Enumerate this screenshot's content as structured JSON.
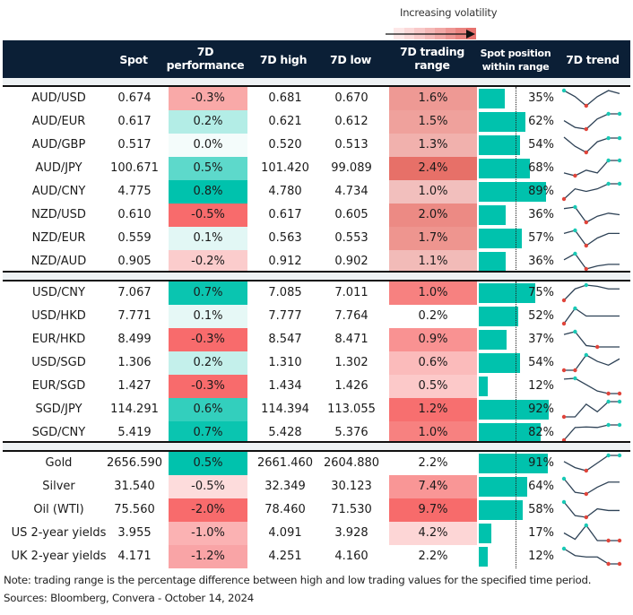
{
  "legend": {
    "label": "Increasing volatility",
    "icon": "arrow-right-icon",
    "gradient": [
      "#fde8e8",
      "#fbd9d9",
      "#f8c9c9",
      "#f5b9b8",
      "#f2a8a6",
      "#ee9693",
      "#ea8480",
      "#e7726e"
    ]
  },
  "header": {
    "spot": "Spot",
    "perf_line1": "7D",
    "perf_line2": "performance",
    "high": "7D high",
    "low": "7D low",
    "range_line1": "7D trading",
    "range_line2": "range",
    "pos_line1": "Spot position",
    "pos_line2": "within range",
    "trend": "7D trend"
  },
  "colors": {
    "header_bg": "#0b1f36",
    "bar": "#00c2ad",
    "spark_line": "#2e4256",
    "spark_high": "#19c9b5",
    "spark_low": "#e0443a"
  },
  "chart_data": {
    "type": "table",
    "title": "",
    "columns": [
      "Instrument",
      "Spot",
      "7D performance",
      "7D high",
      "7D low",
      "7D trading range",
      "Spot position within range",
      "7D trend"
    ],
    "groups": [
      {
        "rows": [
          {
            "name": "AUD/USD",
            "spot": "0.674",
            "perf": "-0.3%",
            "perf_bg": "#f9a9a8",
            "high": "0.681",
            "low": "0.670",
            "range": "1.6%",
            "range_bg": "#ee9994",
            "pos": 35,
            "pos_label": "35%",
            "trend": [
              6,
              4,
              1,
              4,
              6,
              5
            ],
            "trend_hi": [
              0
            ],
            "trend_lo": [
              2
            ]
          },
          {
            "name": "AUD/EUR",
            "spot": "0.617",
            "perf": "0.2%",
            "perf_bg": "#b3ede6",
            "high": "0.621",
            "low": "0.612",
            "range": "1.5%",
            "range_bg": "#efa19c",
            "pos": 62,
            "pos_label": "62%",
            "trend": [
              4,
              2,
              1.5,
              4.5,
              6,
              6
            ],
            "trend_hi": [
              4,
              5
            ],
            "trend_lo": [
              2
            ]
          },
          {
            "name": "AUD/GBP",
            "spot": "0.517",
            "perf": "0.0%",
            "perf_bg": "#f4fcfb",
            "high": "0.520",
            "low": "0.513",
            "range": "1.3%",
            "range_bg": "#f1b1ad",
            "pos": 54,
            "pos_label": "54%",
            "trend": [
              6,
              3,
              1,
              4.5,
              5.7,
              5.7
            ],
            "trend_hi": [
              4,
              5
            ],
            "trend_lo": [
              2
            ]
          },
          {
            "name": "AUD/JPY",
            "spot": "100.671",
            "perf": "0.5%",
            "perf_bg": "#5dd9cb",
            "high": "101.420",
            "low": "99.089",
            "range": "2.4%",
            "range_bg": "#e77068",
            "pos": 68,
            "pos_label": "68%",
            "trend": [
              1.5,
              0.5,
              2.5,
              1.5,
              6,
              6
            ],
            "trend_hi": [
              4,
              5
            ],
            "trend_lo": [
              1
            ]
          },
          {
            "name": "AUD/CNY",
            "spot": "4.775",
            "perf": "0.8%",
            "perf_bg": "#00c2ad",
            "high": "4.780",
            "low": "4.734",
            "range": "1.0%",
            "range_bg": "#f2bfbd",
            "pos": 89,
            "pos_label": "89%",
            "trend": [
              0.5,
              4.5,
              3.5,
              4.5,
              6.5,
              6.5
            ],
            "trend_hi": [
              4,
              5
            ],
            "trend_lo": [
              0
            ]
          },
          {
            "name": "NZD/USD",
            "spot": "0.610",
            "perf": "-0.5%",
            "perf_bg": "#f86b6c",
            "high": "0.617",
            "low": "0.605",
            "range": "2.0%",
            "range_bg": "#ec8a84",
            "pos": 36,
            "pos_label": "36%",
            "trend": [
              5.5,
              6,
              1,
              3,
              4,
              3.5
            ],
            "trend_hi": [
              1
            ],
            "trend_lo": [
              2
            ]
          },
          {
            "name": "NZD/EUR",
            "spot": "0.559",
            "perf": "0.1%",
            "perf_bg": "#e2f7f5",
            "high": "0.563",
            "low": "0.553",
            "range": "1.7%",
            "range_bg": "#ee958f",
            "pos": 57,
            "pos_label": "57%",
            "trend": [
              4.5,
              5.5,
              0.5,
              3,
              4.5,
              4.5
            ],
            "trend_hi": [
              1
            ],
            "trend_lo": [
              2
            ]
          },
          {
            "name": "NZD/AUD",
            "spot": "0.905",
            "perf": "-0.2%",
            "perf_bg": "#fbcccc",
            "high": "0.912",
            "low": "0.902",
            "range": "1.1%",
            "range_bg": "#f2bbb8",
            "pos": 36,
            "pos_label": "36%",
            "trend": [
              3,
              5,
              0,
              1,
              1.5,
              1.5
            ],
            "trend_hi": [
              1
            ],
            "trend_lo": [
              2
            ]
          }
        ]
      },
      {
        "rows": [
          {
            "name": "USD/CNY",
            "spot": "7.067",
            "perf": "0.7%",
            "perf_bg": "#0ac5b0",
            "high": "7.085",
            "low": "7.011",
            "range": "1.0%",
            "range_bg": "#f78180",
            "pos": 75,
            "pos_label": "75%",
            "trend": [
              0,
              4.5,
              6,
              5.5,
              4.5,
              4.5
            ],
            "trend_hi": [
              2
            ],
            "trend_lo": [
              0
            ]
          },
          {
            "name": "USD/HKD",
            "spot": "7.771",
            "perf": "0.1%",
            "perf_bg": "#e6f8f6",
            "high": "7.777",
            "low": "7.764",
            "range": "0.2%",
            "range_bg": "#ffffff",
            "pos": 52,
            "pos_label": "52%",
            "trend": [
              0,
              6,
              3,
              3,
              3,
              3
            ],
            "trend_hi": [
              1
            ],
            "trend_lo": [
              0
            ]
          },
          {
            "name": "EUR/HKD",
            "spot": "8.499",
            "perf": "-0.3%",
            "perf_bg": "#f86b6c",
            "high": "8.547",
            "low": "8.471",
            "range": "0.9%",
            "range_bg": "#f99292",
            "pos": 37,
            "pos_label": "37%",
            "trend": [
              4.5,
              5.5,
              0.5,
              0,
              0,
              0
            ],
            "trend_hi": [
              1
            ],
            "trend_lo": [
              3
            ]
          },
          {
            "name": "USD/SGD",
            "spot": "1.306",
            "perf": "0.2%",
            "perf_bg": "#c4f0eb",
            "high": "1.310",
            "low": "1.302",
            "range": "0.6%",
            "range_bg": "#fbbbbb",
            "pos": 54,
            "pos_label": "54%",
            "trend": [
              0,
              0,
              6,
              3.5,
              2,
              4.5
            ],
            "trend_hi": [
              2
            ],
            "trend_lo": [
              0,
              1
            ]
          },
          {
            "name": "EUR/SGD",
            "spot": "1.427",
            "perf": "-0.3%",
            "perf_bg": "#f86b6c",
            "high": "1.434",
            "low": "1.426",
            "range": "0.5%",
            "range_bg": "#fcc9c9",
            "pos": 12,
            "pos_label": "12%",
            "trend": [
              5.7,
              6,
              3.5,
              1,
              0,
              0
            ],
            "trend_hi": [
              1
            ],
            "trend_lo": [
              4,
              5
            ]
          },
          {
            "name": "SGD/JPY",
            "spot": "114.291",
            "perf": "0.6%",
            "perf_bg": "#33cfbd",
            "high": "114.394",
            "low": "113.055",
            "range": "1.2%",
            "range_bg": "#f76f6f",
            "pos": 92,
            "pos_label": "92%",
            "trend": [
              0,
              0,
              5,
              2,
              6,
              6
            ],
            "trend_hi": [
              4,
              5
            ],
            "trend_lo": [
              0
            ]
          },
          {
            "name": "SGD/CNY",
            "spot": "5.419",
            "perf": "0.7%",
            "perf_bg": "#0ac5b0",
            "high": "5.428",
            "low": "5.376",
            "range": "1.0%",
            "range_bg": "#f78180",
            "pos": 82,
            "pos_label": "82%",
            "trend": [
              0,
              5,
              5.2,
              5,
              6,
              6
            ],
            "trend_hi": [
              4,
              5
            ],
            "trend_lo": [
              0
            ]
          }
        ]
      },
      {
        "rows": [
          {
            "name": "Gold",
            "spot": "2656.590",
            "perf": "0.5%",
            "perf_bg": "#00c2ad",
            "high": "2661.460",
            "low": "2604.880",
            "range": "2.2%",
            "range_bg": "#ffffff",
            "pos": 91,
            "pos_label": "91%",
            "trend": [
              4,
              2,
              1,
              3.5,
              6,
              6
            ],
            "trend_hi": [
              4,
              5
            ],
            "trend_lo": [
              2
            ]
          },
          {
            "name": "Silver",
            "spot": "31.540",
            "perf": "-0.5%",
            "perf_bg": "#fddcdc",
            "high": "32.349",
            "low": "30.123",
            "range": "7.4%",
            "range_bg": "#f99696",
            "pos": 64,
            "pos_label": "64%",
            "trend": [
              6,
              2,
              1.5,
              3.5,
              5,
              5
            ],
            "trend_hi": [
              0
            ],
            "trend_lo": [
              2
            ]
          },
          {
            "name": "Oil (WTI)",
            "spot": "75.560",
            "perf": "-2.0%",
            "perf_bg": "#f86b6c",
            "high": "78.460",
            "low": "71.530",
            "range": "9.7%",
            "range_bg": "#f76b6b",
            "pos": 58,
            "pos_label": "58%",
            "trend": [
              6,
              2,
              1.5,
              4,
              3.5,
              3.5
            ],
            "trend_hi": [
              0
            ],
            "trend_lo": [
              2
            ]
          },
          {
            "name": "US 2-year yields",
            "spot": "3.955",
            "perf": "-1.0%",
            "perf_bg": "#fbb2b3",
            "high": "4.091",
            "low": "3.928",
            "range": "4.2%",
            "range_bg": "#fdd6d6",
            "pos": 17,
            "pos_label": "17%",
            "trend": [
              3,
              0.5,
              6,
              0,
              0,
              0
            ],
            "trend_hi": [
              2
            ],
            "trend_lo": [
              4,
              5
            ]
          },
          {
            "name": "UK 2-year yields",
            "spot": "4.171",
            "perf": "-1.2%",
            "perf_bg": "#f9a4a6",
            "high": "4.251",
            "low": "4.160",
            "range": "2.2%",
            "range_bg": "#ffffff",
            "pos": 12,
            "pos_label": "12%",
            "trend": [
              6,
              3.5,
              3,
              3,
              0.5,
              0.5
            ],
            "trend_hi": [
              0
            ],
            "trend_lo": [
              4,
              5
            ]
          }
        ]
      }
    ]
  },
  "footer": {
    "note": "Note: trading range is the percentage difference between high and low trading values for the specified time period.",
    "sources": "Sources: Bloomberg, Convera - October 14, 2024"
  }
}
